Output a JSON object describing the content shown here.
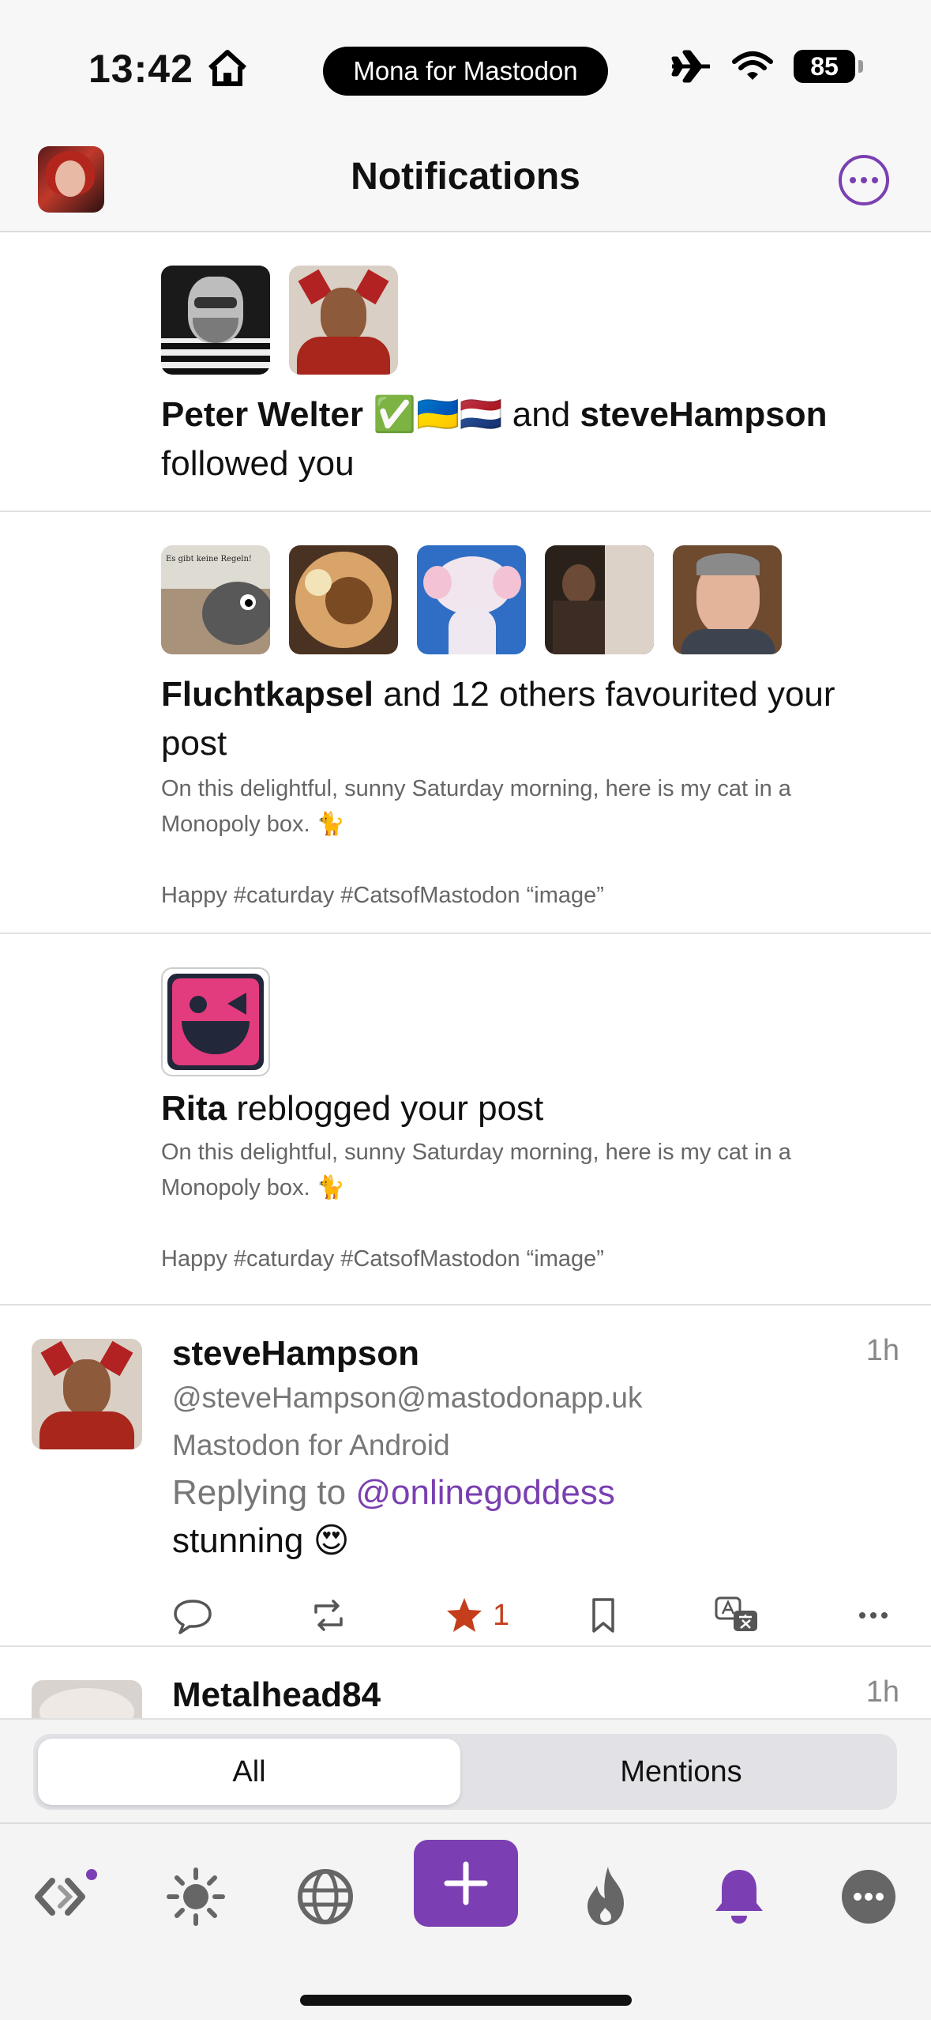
{
  "status_bar": {
    "time": "13:42",
    "app_pill": "Mona for Mastodon",
    "battery": "85"
  },
  "nav": {
    "title": "Notifications"
  },
  "notifications": [
    {
      "type": "follow",
      "name1": "Peter Welter",
      "emoji": "✅🇺🇦🇳🇱",
      "conj": " and ",
      "name2": "steveHampson",
      "action": "followed you"
    },
    {
      "type": "favourite",
      "name": "Fluchtkapsel",
      "action": " and 12 others favourited your post",
      "preview_line1": "On this delightful, sunny Saturday morning, here is my cat in a Monopoly box. 🐈",
      "preview_line2": "Happy #caturday #CatsofMastodon “image”",
      "thumb1_text": "Es gibt keine Regeln!"
    },
    {
      "type": "reblog",
      "name": "Rita",
      "action": " reblogged your post",
      "preview_line1": "On this delightful, sunny Saturday morning, here is my cat in a Monopoly box. 🐈",
      "preview_line2": "Happy #caturday #CatsofMastodon “image”"
    }
  ],
  "post": {
    "name": "steveHampson",
    "time": "1h",
    "handle": "@steveHampson@mastodonapp.uk",
    "client": "Mastodon for Android",
    "reply_prefix": "Replying to ",
    "reply_mention": "@onlinegoddess",
    "body": "stunning 😍",
    "fav_count": "1"
  },
  "post2": {
    "name": "Metalhead84",
    "time": "1h"
  },
  "segmented": {
    "all": "All",
    "mentions": "Mentions"
  },
  "colors": {
    "accent": "#7c3fb3",
    "favourite": "#c43e1c",
    "mention": "#7a3fb0"
  }
}
